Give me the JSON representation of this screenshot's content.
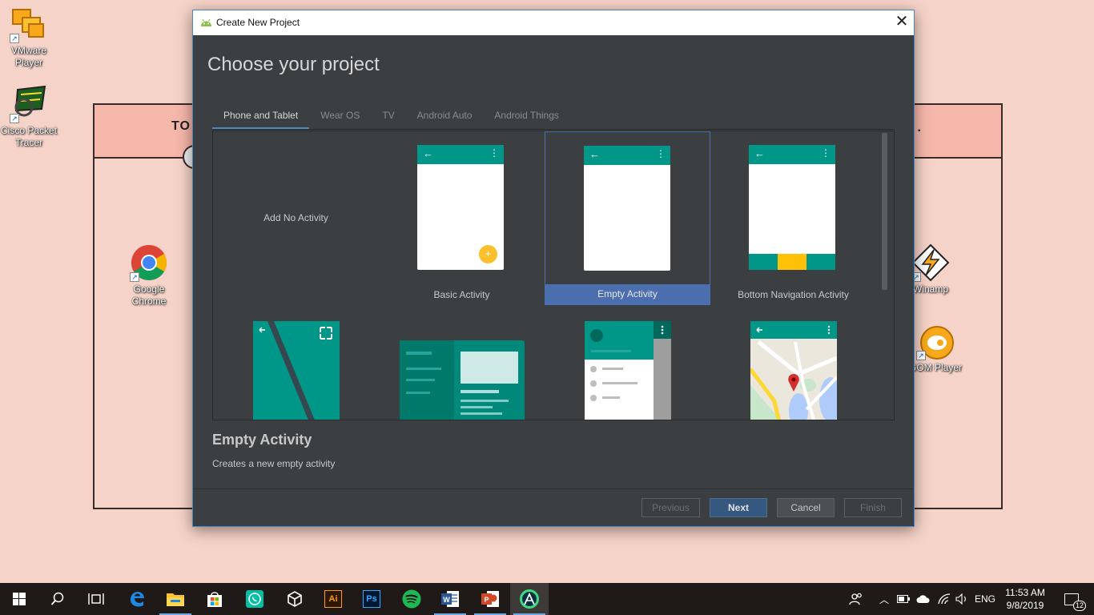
{
  "desktop": {
    "icons": [
      {
        "label": "VMware Player"
      },
      {
        "label": "Cisco Packet Tracer"
      },
      {
        "label": "Google Chrome"
      },
      {
        "label": "Winamp"
      },
      {
        "label": "GOM Player"
      }
    ],
    "bg_header_text": "TO"
  },
  "dialog": {
    "window_title": "Create New Project",
    "heading": "Choose your project",
    "tabs": [
      {
        "label": "Phone and Tablet",
        "active": true
      },
      {
        "label": "Wear OS"
      },
      {
        "label": "TV"
      },
      {
        "label": "Android Auto"
      },
      {
        "label": "Android Things"
      }
    ],
    "templates": [
      {
        "label": "Add No Activity"
      },
      {
        "label": "Basic Activity"
      },
      {
        "label": "Empty Activity",
        "selected": true
      },
      {
        "label": "Bottom Navigation Activity"
      }
    ],
    "description": {
      "title": "Empty Activity",
      "text": "Creates a new empty activity"
    },
    "buttons": {
      "previous": "Previous",
      "next": "Next",
      "cancel": "Cancel",
      "finish": "Finish"
    },
    "colors": {
      "accent": "#4b6eaf",
      "material_teal": "#009688",
      "fab_yellow": "#fbc02d"
    }
  },
  "taskbar": {
    "apps": [
      "start",
      "search",
      "task-view",
      "edge",
      "file-explorer",
      "store",
      "whatsapp",
      "unity",
      "illustrator",
      "photoshop",
      "spotify",
      "word",
      "powerpoint",
      "android-studio"
    ],
    "language": "ENG",
    "time": "11:53 AM",
    "date": "9/8/2019",
    "notification_count": "12"
  }
}
